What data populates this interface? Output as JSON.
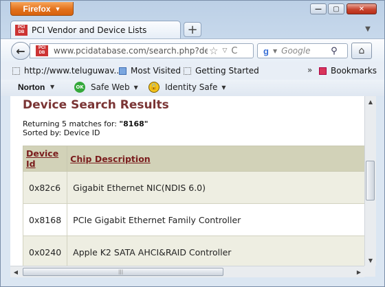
{
  "window": {
    "app_button_label": "Firefox",
    "app_button_caret": "▼",
    "minimize_glyph": "—",
    "maximize_glyph": "▢",
    "close_glyph": "✕"
  },
  "tabs": {
    "active_title": "PCI Vendor and Device Lists",
    "favicon_top": "PCI",
    "favicon_bottom": "DB",
    "new_tab_glyph": "+",
    "list_glyph": "▼"
  },
  "nav": {
    "back_glyph": "←",
    "url": "www.pcidatabase.com/search.php?device_",
    "star_glyph": "☆",
    "drop_glyph": "▽",
    "reload_glyph": "C",
    "search_engine_glyph": "g",
    "search_placeholder": "Google",
    "search_glyph": "⚲",
    "home_glyph": "⌂"
  },
  "bookmarks": {
    "item1": "http://www.teluguwav...",
    "item2": "Most Visited",
    "item3": "Getting Started",
    "more_glyph": "»",
    "bookmarks_label": "Bookmarks"
  },
  "norton": {
    "brand": "Norton",
    "caret": "▼",
    "safe_web_icon_text": "OK",
    "safe_web_label": "Safe Web",
    "identity_safe_label": "Identity Safe"
  },
  "page": {
    "heading": "Device Search Results",
    "returning_prefix": "Returning 5 matches for: ",
    "query": "\"8168\"",
    "sorted_by": "Sorted by: Device ID",
    "columns": {
      "device_id": "Device Id",
      "chip_description": "Chip Description"
    },
    "rows": [
      {
        "id": "0x82c6",
        "desc": "Gigabit Ethernet NIC(NDIS 6.0)"
      },
      {
        "id": "0x8168",
        "desc": "PCIe Gigabit Ethernet Family Controller"
      },
      {
        "id": "0x0240",
        "desc": "Apple K2 SATA AHCI&RAID Controller"
      }
    ]
  },
  "scrollbars": {
    "up": "▲",
    "down": "▼",
    "left": "◀",
    "right": "▶",
    "grip": "|||"
  }
}
